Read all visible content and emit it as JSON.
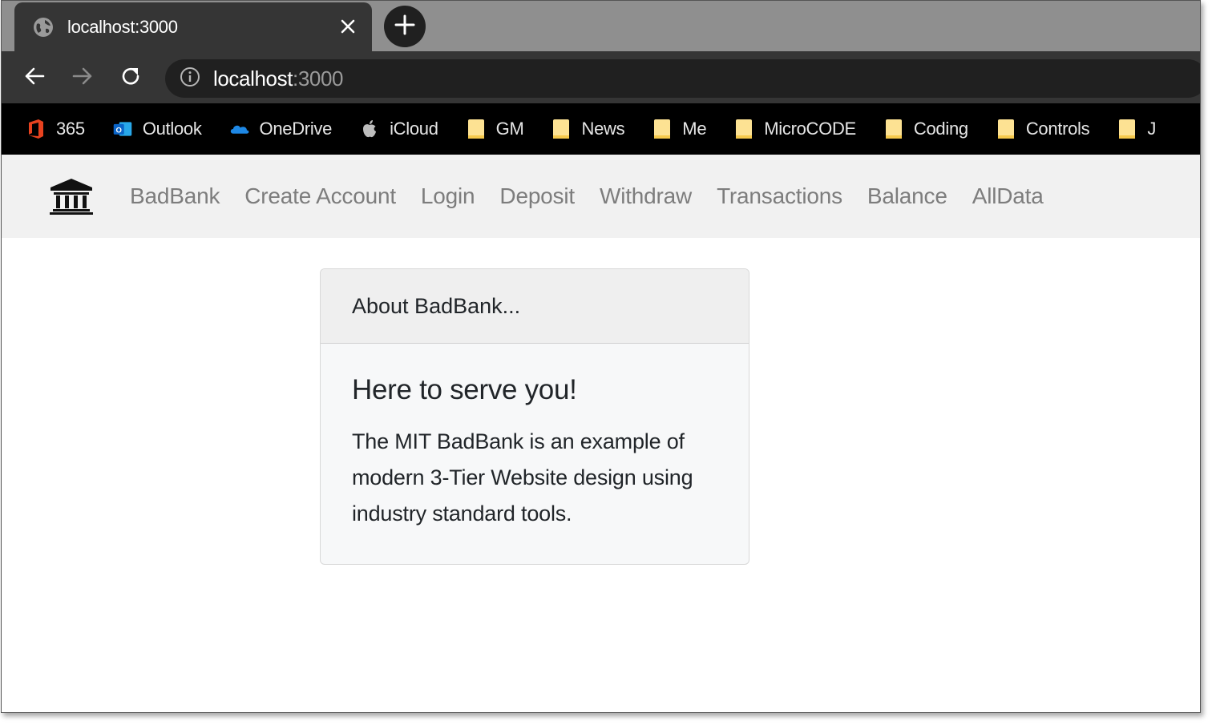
{
  "browser": {
    "tab": {
      "title": "localhost:3000",
      "icon": "globe-icon"
    },
    "new_tab_icon": "plus-icon",
    "address": {
      "host": "localhost",
      "port": ":3000"
    },
    "bookmarks": [
      {
        "label": "365",
        "icon": "office-icon"
      },
      {
        "label": "Outlook",
        "icon": "outlook-icon"
      },
      {
        "label": "OneDrive",
        "icon": "onedrive-icon"
      },
      {
        "label": "iCloud",
        "icon": "apple-icon"
      },
      {
        "label": "GM",
        "icon": "folder-icon"
      },
      {
        "label": "News",
        "icon": "folder-icon"
      },
      {
        "label": "Me",
        "icon": "folder-icon"
      },
      {
        "label": "MicroCODE",
        "icon": "folder-icon"
      },
      {
        "label": "Coding",
        "icon": "folder-icon"
      },
      {
        "label": "Controls",
        "icon": "folder-icon"
      },
      {
        "label": "J",
        "icon": "folder-icon"
      }
    ]
  },
  "navbar": {
    "brand_icon": "bank-icon",
    "links": [
      "BadBank",
      "Create Account",
      "Login",
      "Deposit",
      "Withdraw",
      "Transactions",
      "Balance",
      "AllData"
    ]
  },
  "card": {
    "header": "About BadBank...",
    "title": "Here to serve you!",
    "text": "The MIT BadBank is an example of modern 3-Tier Website design using industry standard tools."
  },
  "colors": {
    "tabstrip": "#8f8f8f",
    "toolbar": "#353535",
    "bookmarks_bar": "#000000",
    "navbar": "#f1f1f1",
    "nav_link": "#7d7d7d",
    "card_header": "#efefef"
  }
}
